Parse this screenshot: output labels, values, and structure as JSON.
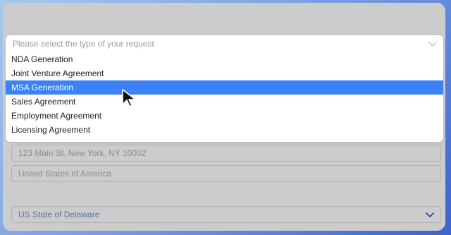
{
  "dropdown": {
    "placeholder": "Please select the type of your request",
    "options": [
      {
        "label": "NDA Generation"
      },
      {
        "label": "Joint Venture Agreement"
      },
      {
        "label": "MSA Generation"
      },
      {
        "label": "Sales Agreement"
      },
      {
        "label": "Employment Agreement"
      },
      {
        "label": "Licensing Agreement"
      }
    ],
    "selected": "MSA Generation"
  },
  "form": {
    "address_placeholder": "123 Main St. New York, NY 10002",
    "country_placeholder": "United States of America",
    "state_value": "US State of Delaware"
  },
  "colors": {
    "highlight": "#3b82f6",
    "state_text": "#6f8fd3",
    "chevron": "#3b5fc0"
  },
  "icons": [
    "chevron-down-icon",
    "mouse-cursor-icon"
  ]
}
